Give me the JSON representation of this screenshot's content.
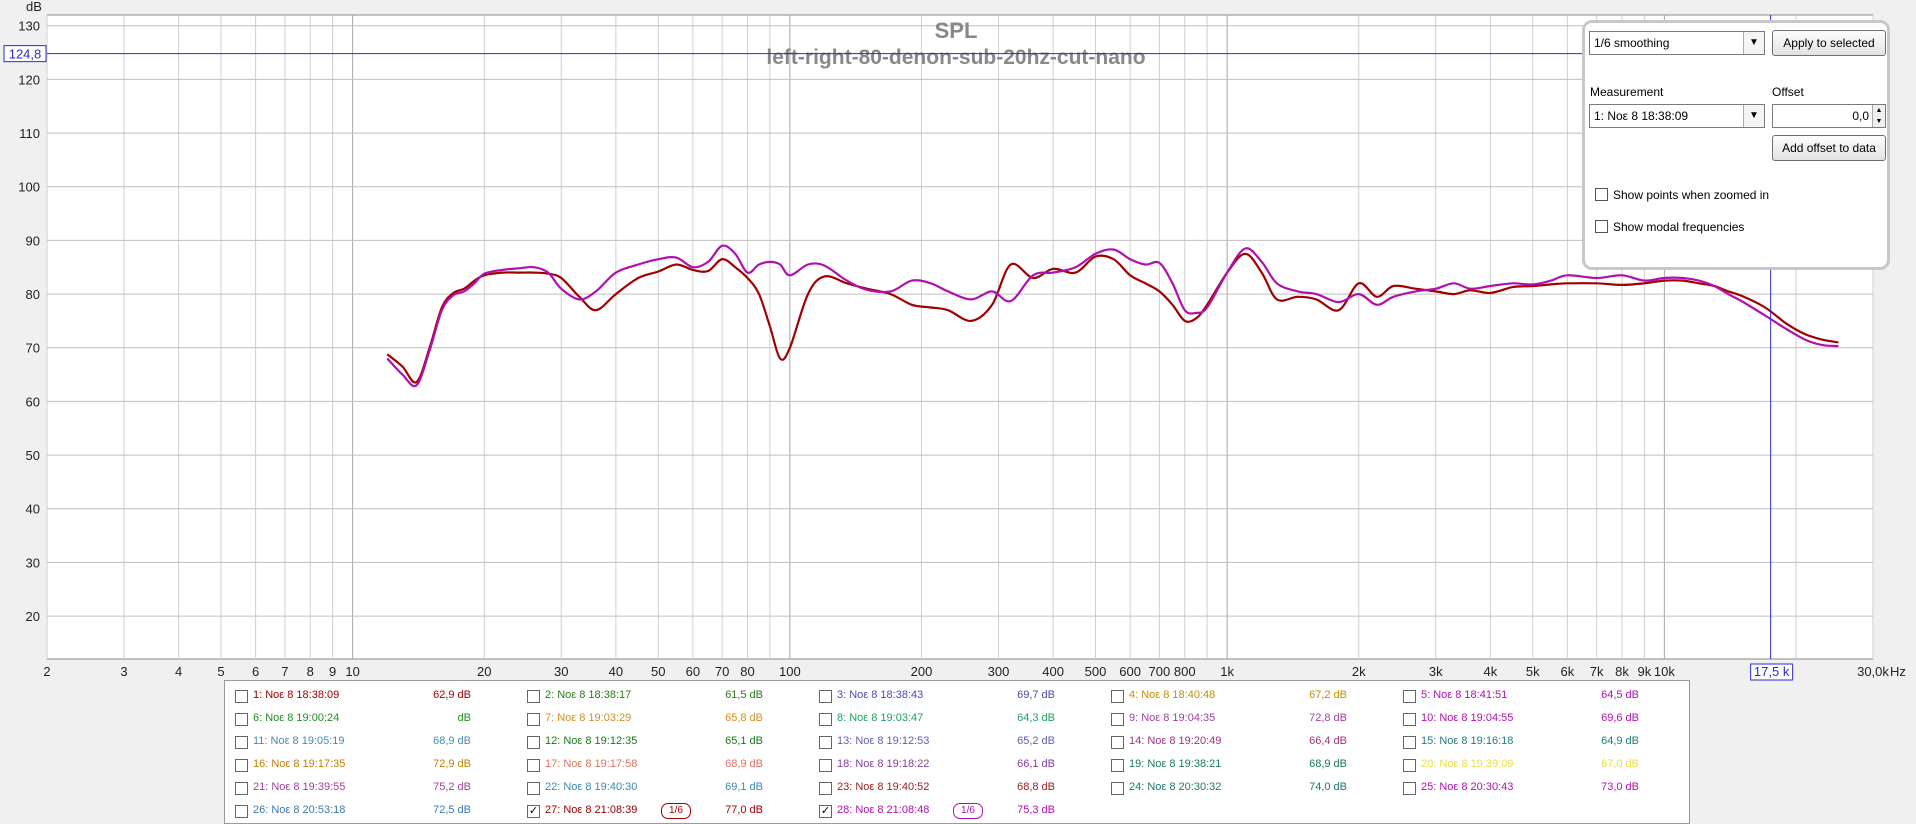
{
  "chart_data": {
    "type": "line",
    "title": "SPL",
    "subtitle": "left-right-80-denon-sub-20hz-cut-nano",
    "ylabel": "dB",
    "xlabel": "Hz",
    "xscale": "log",
    "xlim": [
      2,
      30000
    ],
    "ylim": [
      12,
      132
    ],
    "grid": true,
    "y_ticks": [
      20,
      30,
      40,
      50,
      60,
      70,
      80,
      90,
      100,
      110,
      120,
      130
    ],
    "x_ticks": [
      {
        "v": 2,
        "label": "2"
      },
      {
        "v": 3,
        "label": "3"
      },
      {
        "v": 4,
        "label": "4"
      },
      {
        "v": 5,
        "label": "5"
      },
      {
        "v": 6,
        "label": "6"
      },
      {
        "v": 7,
        "label": "7"
      },
      {
        "v": 8,
        "label": "8"
      },
      {
        "v": 9,
        "label": "9"
      },
      {
        "v": 10,
        "label": "10"
      },
      {
        "v": 20,
        "label": "20"
      },
      {
        "v": 30,
        "label": "30"
      },
      {
        "v": 40,
        "label": "40"
      },
      {
        "v": 50,
        "label": "50"
      },
      {
        "v": 60,
        "label": "60"
      },
      {
        "v": 70,
        "label": "70"
      },
      {
        "v": 80,
        "label": "80"
      },
      {
        "v": 100,
        "label": "100"
      },
      {
        "v": 200,
        "label": "200"
      },
      {
        "v": 300,
        "label": "300"
      },
      {
        "v": 400,
        "label": "400"
      },
      {
        "v": 500,
        "label": "500"
      },
      {
        "v": 600,
        "label": "600"
      },
      {
        "v": 700,
        "label": "700"
      },
      {
        "v": 800,
        "label": "800"
      },
      {
        "v": 1000,
        "label": "1k"
      },
      {
        "v": 2000,
        "label": "2k"
      },
      {
        "v": 3000,
        "label": "3k"
      },
      {
        "v": 4000,
        "label": "4k"
      },
      {
        "v": 5000,
        "label": "5k"
      },
      {
        "v": 6000,
        "label": "6k"
      },
      {
        "v": 7000,
        "label": "7k"
      },
      {
        "v": 8000,
        "label": "8k"
      },
      {
        "v": 9000,
        "label": "9k"
      },
      {
        "v": 10000,
        "label": "10k"
      },
      {
        "v": 30000,
        "label": "30,0k"
      }
    ],
    "cursor": {
      "x": 17500,
      "x_label": "17,5 k",
      "y": 124.8,
      "y_label": "124,8"
    },
    "series": [
      {
        "name": "27: Νοε 8 21:08:39",
        "color": "#a00000",
        "x": [
          12,
          13,
          14,
          15,
          16,
          17,
          18,
          19,
          20,
          22,
          24,
          26,
          28,
          30,
          33,
          36,
          40,
          45,
          50,
          55,
          60,
          65,
          70,
          75,
          80,
          85,
          90,
          95,
          100,
          110,
          120,
          135,
          150,
          170,
          190,
          210,
          230,
          260,
          290,
          320,
          360,
          400,
          450,
          500,
          550,
          600,
          650,
          700,
          750,
          800,
          850,
          900,
          1000,
          1100,
          1200,
          1300,
          1450,
          1600,
          1800,
          2000,
          2200,
          2400,
          2700,
          3000,
          3300,
          3600,
          4000,
          4500,
          5000,
          5500,
          6000,
          7000,
          8000,
          9000,
          10000,
          11000,
          12000,
          13000,
          14000,
          15000,
          17000,
          19000,
          21000,
          23000,
          25000
        ],
        "y": [
          68.8,
          66.5,
          63.6,
          70.0,
          77.5,
          80.2,
          81.0,
          82.5,
          83.5,
          84.0,
          84.0,
          84.0,
          83.8,
          83.0,
          79.5,
          77.0,
          80.0,
          83.0,
          84.2,
          85.5,
          84.5,
          84.3,
          86.5,
          85.0,
          83.0,
          80.0,
          74.0,
          68.0,
          70.0,
          80.0,
          83.3,
          82.0,
          81.0,
          80.0,
          78.0,
          77.5,
          77.0,
          75.0,
          78.0,
          85.5,
          83.0,
          84.7,
          84.0,
          87.0,
          86.5,
          83.5,
          82.0,
          80.5,
          78.0,
          75.0,
          75.5,
          78.0,
          84.0,
          87.5,
          84.0,
          79.0,
          79.5,
          79.0,
          77.0,
          82.0,
          79.5,
          81.5,
          81.0,
          80.5,
          80.0,
          80.7,
          80.2,
          81.3,
          81.5,
          81.8,
          82.0,
          82.0,
          81.7,
          82.0,
          82.5,
          82.5,
          82.0,
          81.5,
          80.5,
          79.7,
          77.5,
          74.5,
          72.5,
          71.5,
          71.0
        ]
      },
      {
        "name": "28: Νοε 8 21:08:48",
        "color": "#b010b0",
        "x": [
          12,
          13,
          14,
          15,
          16,
          17,
          18,
          19,
          20,
          22,
          24,
          26,
          28,
          30,
          33,
          36,
          40,
          45,
          50,
          55,
          60,
          65,
          70,
          75,
          80,
          85,
          90,
          95,
          100,
          110,
          120,
          135,
          150,
          170,
          190,
          210,
          230,
          260,
          290,
          320,
          360,
          400,
          450,
          500,
          550,
          600,
          650,
          700,
          750,
          800,
          850,
          900,
          1000,
          1100,
          1200,
          1300,
          1450,
          1600,
          1800,
          2000,
          2200,
          2400,
          2700,
          3000,
          3300,
          3600,
          4000,
          4500,
          5000,
          5500,
          6000,
          7000,
          8000,
          9000,
          10000,
          11000,
          12000,
          13000,
          14000,
          15000,
          17000,
          19000,
          21000,
          23000,
          25000
        ],
        "y": [
          68.0,
          65.0,
          63.0,
          69.5,
          77.0,
          79.8,
          80.5,
          82.0,
          83.8,
          84.5,
          84.8,
          85.0,
          84.0,
          81.0,
          79.0,
          80.5,
          84.0,
          85.5,
          86.5,
          86.8,
          85.0,
          86.0,
          89.0,
          87.5,
          84.0,
          85.5,
          86.0,
          85.5,
          83.5,
          85.5,
          85.3,
          82.5,
          80.8,
          80.5,
          82.5,
          82.0,
          80.5,
          79.0,
          80.5,
          78.7,
          83.5,
          84.0,
          85.0,
          87.5,
          88.3,
          86.5,
          85.5,
          85.8,
          82.0,
          77.0,
          76.5,
          77.5,
          84.0,
          88.5,
          86.0,
          82.0,
          80.5,
          80.0,
          78.5,
          80.0,
          78.0,
          79.5,
          80.5,
          81.0,
          82.0,
          81.0,
          81.5,
          82.0,
          81.8,
          82.5,
          83.5,
          83.0,
          83.5,
          82.5,
          83.0,
          83.0,
          82.5,
          81.5,
          80.0,
          78.7,
          76.0,
          73.5,
          71.5,
          70.5,
          70.3
        ]
      }
    ]
  },
  "panel": {
    "smoothing": "1/6 smoothing",
    "apply_label": "Apply to selected",
    "measurement_label": "Measurement",
    "offset_label": "Offset",
    "measurement_value": "1: Νοε 8 18:38:09",
    "offset_value": "0,0",
    "add_offset_label": "Add offset to data",
    "show_points_label": "Show points when zoomed in",
    "show_modal_label": "Show modal frequencies"
  },
  "legend": [
    {
      "name": "1: Νοε 8 18:38:09",
      "value": "62,9 dB",
      "color": "#a00000",
      "checked": false
    },
    {
      "name": "2: Νοε 8 18:38:17",
      "value": "61,5 dB",
      "color": "#2a7a1a",
      "checked": false
    },
    {
      "name": "3: Νοε 8 18:38:43",
      "value": "69,7 dB",
      "color": "#4a4ab0",
      "checked": false
    },
    {
      "name": "4: Νοε 8 18:40:48",
      "value": "67,2 dB",
      "color": "#c09000",
      "checked": false
    },
    {
      "name": "5: Νοε 8 18:41:51",
      "value": "64,5 dB",
      "color": "#b010b0",
      "checked": false
    },
    {
      "name": "6: Νοε 8 19:00:24",
      "value": "dB",
      "color": "#1f8f1f",
      "checked": false
    },
    {
      "name": "7: Νοε 8 19:03:29",
      "value": "65,8 dB",
      "color": "#d09020",
      "checked": false
    },
    {
      "name": "8: Νοε 8 19:03:47",
      "value": "64,3 dB",
      "color": "#20a060",
      "checked": false
    },
    {
      "name": "9: Νοε 8 19:04:35",
      "value": "72,8 dB",
      "color": "#a040a0",
      "checked": false
    },
    {
      "name": "10: Νοε 8 19:04:55",
      "value": "69,6 dB",
      "color": "#b010b0",
      "checked": false
    },
    {
      "name": "11: Νοε 8 19:05:19",
      "value": "68,9 dB",
      "color": "#4a8ab0",
      "checked": false
    },
    {
      "name": "12: Νοε 8 19:12:35",
      "value": "65,1 dB",
      "color": "#1a7a1a",
      "checked": false
    },
    {
      "name": "13: Νοε 8 19:12:53",
      "value": "65,2 dB",
      "color": "#6060b0",
      "checked": false
    },
    {
      "name": "14: Νοε 8 19:20:49",
      "value": "66,4 dB",
      "color": "#a03080",
      "checked": false
    },
    {
      "name": "15: Νοε 8 19:16:18",
      "value": "64,9 dB",
      "color": "#207a7a",
      "checked": false
    },
    {
      "name": "16: Νοε 8 19:17:35",
      "value": "72,9 dB",
      "color": "#c08000",
      "checked": false
    },
    {
      "name": "17: Νοε 8 19:17:58",
      "value": "68,9 dB",
      "color": "#e07060",
      "checked": false
    },
    {
      "name": "18: Νοε 8 19:18:22",
      "value": "66,1 dB",
      "color": "#8040a0",
      "checked": false
    },
    {
      "name": "19: Νοε 8 19:38:21",
      "value": "68,9 dB",
      "color": "#1a7a5a",
      "checked": false
    },
    {
      "name": "20: Νοε 8 19:39:09",
      "value": "67,0 dB",
      "color": "#e8e040",
      "checked": false
    },
    {
      "name": "21: Νοε 8 19:39:55",
      "value": "75,2 dB",
      "color": "#a040a0",
      "checked": false
    },
    {
      "name": "22: Νοε 8 19:40:30",
      "value": "69,1 dB",
      "color": "#3a8ab0",
      "checked": false
    },
    {
      "name": "23: Νοε 8 19:40:52",
      "value": "68,8 dB",
      "color": "#a02020",
      "checked": false
    },
    {
      "name": "24: Νοε 8 20:30:32",
      "value": "74,0 dB",
      "color": "#1a7a6a",
      "checked": false
    },
    {
      "name": "25: Νοε 8 20:30:43",
      "value": "73,0 dB",
      "color": "#b010b0",
      "checked": false
    },
    {
      "name": "26: Νοε 8 20:53:18",
      "value": "72,5 dB",
      "color": "#3a7ab0",
      "checked": false
    },
    {
      "name": "27: Νοε 8 21:08:39",
      "value": "77,0 dB",
      "color": "#a00000",
      "checked": true,
      "smoothing": "1/6"
    },
    {
      "name": "28: Νοε 8 21:08:48",
      "value": "75,3 dB",
      "color": "#b010b0",
      "checked": true,
      "smoothing": "1/6"
    }
  ]
}
